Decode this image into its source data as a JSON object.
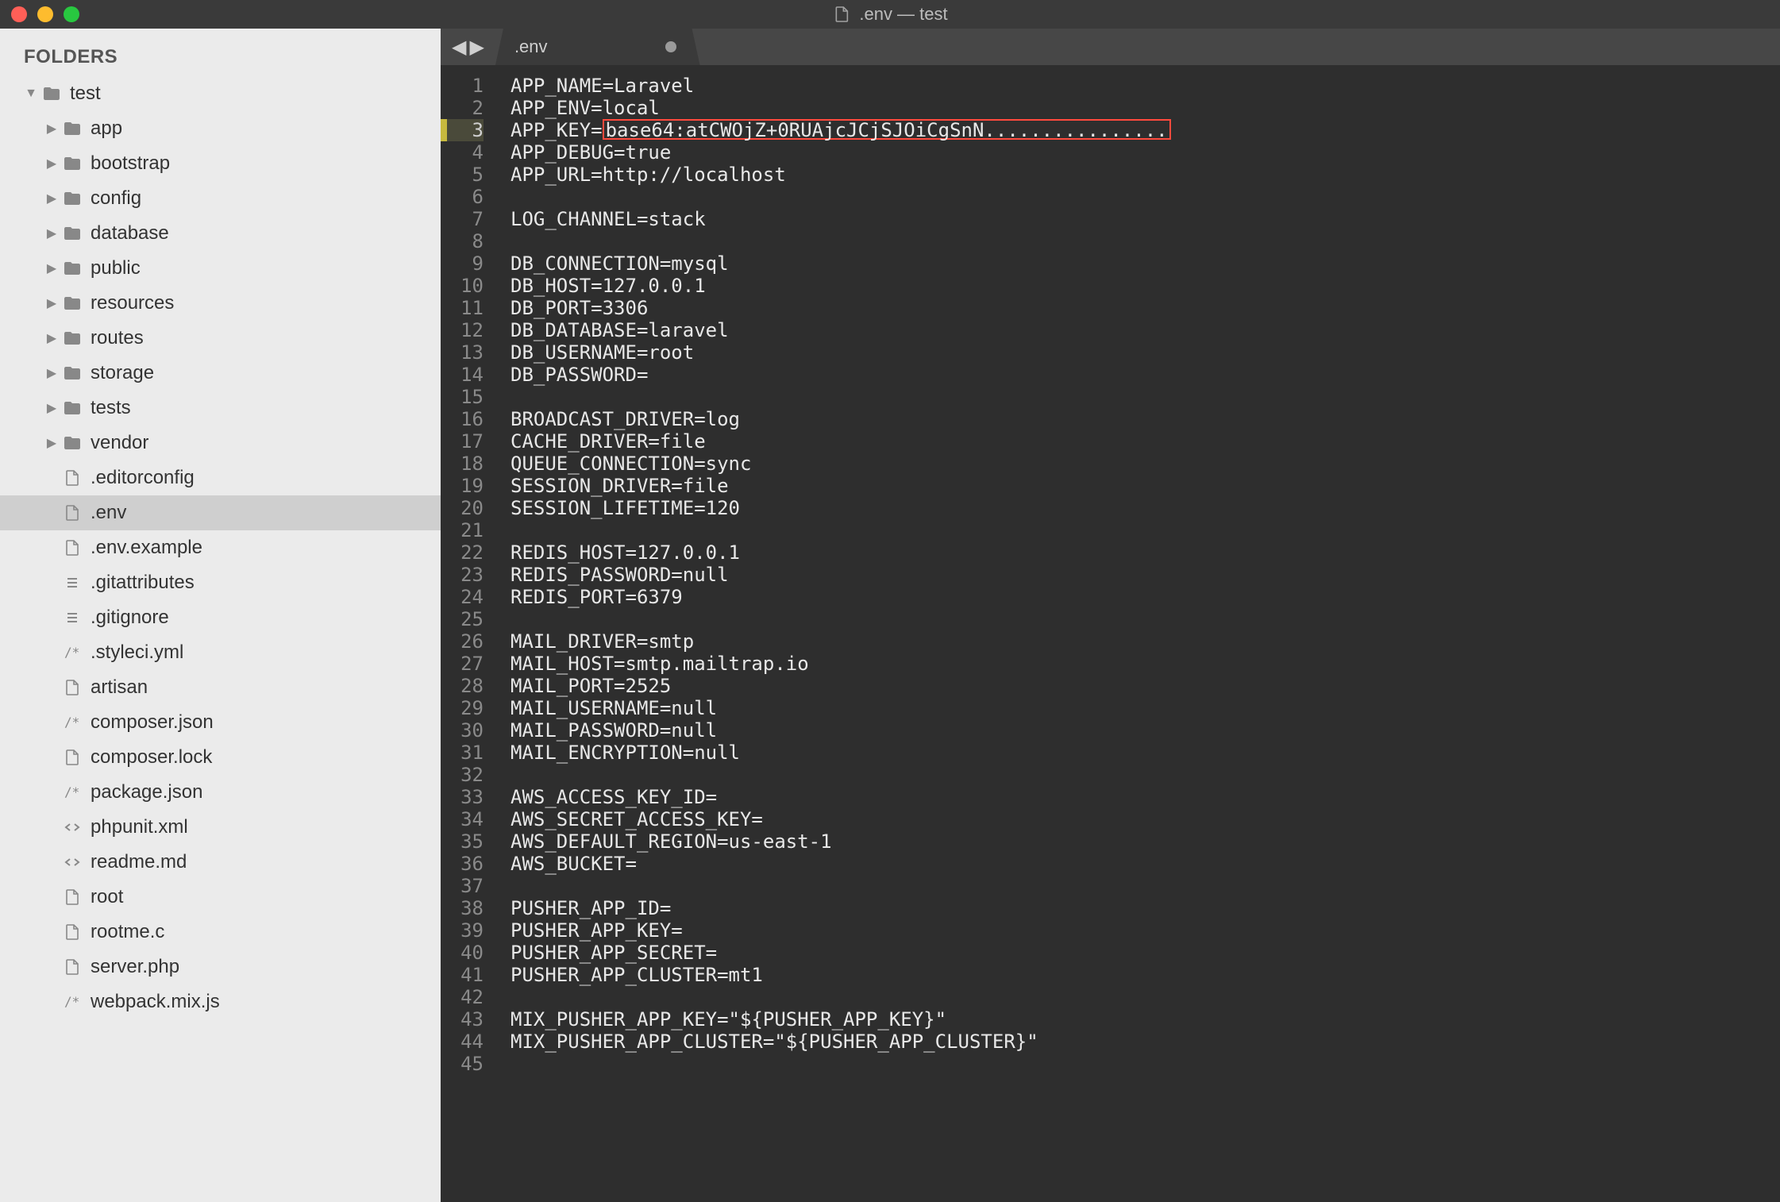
{
  "titlebar": {
    "title": ".env — test"
  },
  "sidebar": {
    "header": "FOLDERS",
    "tree": [
      {
        "depth": 0,
        "type": "folder",
        "expanded": true,
        "label": "test"
      },
      {
        "depth": 1,
        "type": "folder",
        "expanded": false,
        "label": "app"
      },
      {
        "depth": 1,
        "type": "folder",
        "expanded": false,
        "label": "bootstrap"
      },
      {
        "depth": 1,
        "type": "folder",
        "expanded": false,
        "label": "config"
      },
      {
        "depth": 1,
        "type": "folder",
        "expanded": false,
        "label": "database"
      },
      {
        "depth": 1,
        "type": "folder",
        "expanded": false,
        "label": "public"
      },
      {
        "depth": 1,
        "type": "folder",
        "expanded": false,
        "label": "resources"
      },
      {
        "depth": 1,
        "type": "folder",
        "expanded": false,
        "label": "routes"
      },
      {
        "depth": 1,
        "type": "folder",
        "expanded": false,
        "label": "storage"
      },
      {
        "depth": 1,
        "type": "folder",
        "expanded": false,
        "label": "tests"
      },
      {
        "depth": 1,
        "type": "folder",
        "expanded": false,
        "label": "vendor"
      },
      {
        "depth": 1,
        "type": "file",
        "icon": "file",
        "label": ".editorconfig"
      },
      {
        "depth": 1,
        "type": "file",
        "icon": "file",
        "label": ".env",
        "selected": true
      },
      {
        "depth": 1,
        "type": "file",
        "icon": "file",
        "label": ".env.example"
      },
      {
        "depth": 1,
        "type": "file",
        "icon": "list",
        "label": ".gitattributes"
      },
      {
        "depth": 1,
        "type": "file",
        "icon": "list",
        "label": ".gitignore"
      },
      {
        "depth": 1,
        "type": "file",
        "icon": "comment",
        "label": ".styleci.yml"
      },
      {
        "depth": 1,
        "type": "file",
        "icon": "file",
        "label": "artisan"
      },
      {
        "depth": 1,
        "type": "file",
        "icon": "comment",
        "label": "composer.json"
      },
      {
        "depth": 1,
        "type": "file",
        "icon": "file",
        "label": "composer.lock"
      },
      {
        "depth": 1,
        "type": "file",
        "icon": "comment",
        "label": "package.json"
      },
      {
        "depth": 1,
        "type": "file",
        "icon": "code",
        "label": "phpunit.xml"
      },
      {
        "depth": 1,
        "type": "file",
        "icon": "code",
        "label": "readme.md"
      },
      {
        "depth": 1,
        "type": "file",
        "icon": "file",
        "label": "root"
      },
      {
        "depth": 1,
        "type": "file",
        "icon": "file",
        "label": "rootme.c"
      },
      {
        "depth": 1,
        "type": "file",
        "icon": "file",
        "label": "server.php"
      },
      {
        "depth": 1,
        "type": "file",
        "icon": "comment",
        "label": "webpack.mix.js"
      }
    ]
  },
  "tabs": {
    "active": ".env"
  },
  "editor": {
    "highlight_line": 3,
    "lines": [
      {
        "n": 1,
        "text": "APP_NAME=Laravel"
      },
      {
        "n": 2,
        "text": "APP_ENV=local"
      },
      {
        "n": 3,
        "prefix": "APP_KEY=",
        "highlight": "base64:atCWOjZ+0RUAjcJCjSJOiCgSnN................"
      },
      {
        "n": 4,
        "text": "APP_DEBUG=true"
      },
      {
        "n": 5,
        "text": "APP_URL=http://localhost"
      },
      {
        "n": 6,
        "text": ""
      },
      {
        "n": 7,
        "text": "LOG_CHANNEL=stack"
      },
      {
        "n": 8,
        "text": ""
      },
      {
        "n": 9,
        "text": "DB_CONNECTION=mysql"
      },
      {
        "n": 10,
        "text": "DB_HOST=127.0.0.1"
      },
      {
        "n": 11,
        "text": "DB_PORT=3306"
      },
      {
        "n": 12,
        "text": "DB_DATABASE=laravel"
      },
      {
        "n": 13,
        "text": "DB_USERNAME=root"
      },
      {
        "n": 14,
        "text": "DB_PASSWORD="
      },
      {
        "n": 15,
        "text": ""
      },
      {
        "n": 16,
        "text": "BROADCAST_DRIVER=log"
      },
      {
        "n": 17,
        "text": "CACHE_DRIVER=file"
      },
      {
        "n": 18,
        "text": "QUEUE_CONNECTION=sync"
      },
      {
        "n": 19,
        "text": "SESSION_DRIVER=file"
      },
      {
        "n": 20,
        "text": "SESSION_LIFETIME=120"
      },
      {
        "n": 21,
        "text": ""
      },
      {
        "n": 22,
        "text": "REDIS_HOST=127.0.0.1"
      },
      {
        "n": 23,
        "text": "REDIS_PASSWORD=null"
      },
      {
        "n": 24,
        "text": "REDIS_PORT=6379"
      },
      {
        "n": 25,
        "text": ""
      },
      {
        "n": 26,
        "text": "MAIL_DRIVER=smtp"
      },
      {
        "n": 27,
        "text": "MAIL_HOST=smtp.mailtrap.io"
      },
      {
        "n": 28,
        "text": "MAIL_PORT=2525"
      },
      {
        "n": 29,
        "text": "MAIL_USERNAME=null"
      },
      {
        "n": 30,
        "text": "MAIL_PASSWORD=null"
      },
      {
        "n": 31,
        "text": "MAIL_ENCRYPTION=null"
      },
      {
        "n": 32,
        "text": ""
      },
      {
        "n": 33,
        "text": "AWS_ACCESS_KEY_ID="
      },
      {
        "n": 34,
        "text": "AWS_SECRET_ACCESS_KEY="
      },
      {
        "n": 35,
        "text": "AWS_DEFAULT_REGION=us-east-1"
      },
      {
        "n": 36,
        "text": "AWS_BUCKET="
      },
      {
        "n": 37,
        "text": ""
      },
      {
        "n": 38,
        "text": "PUSHER_APP_ID="
      },
      {
        "n": 39,
        "text": "PUSHER_APP_KEY="
      },
      {
        "n": 40,
        "text": "PUSHER_APP_SECRET="
      },
      {
        "n": 41,
        "text": "PUSHER_APP_CLUSTER=mt1"
      },
      {
        "n": 42,
        "text": ""
      },
      {
        "n": 43,
        "text": "MIX_PUSHER_APP_KEY=\"${PUSHER_APP_KEY}\""
      },
      {
        "n": 44,
        "text": "MIX_PUSHER_APP_CLUSTER=\"${PUSHER_APP_CLUSTER}\""
      },
      {
        "n": 45,
        "text": ""
      }
    ]
  }
}
